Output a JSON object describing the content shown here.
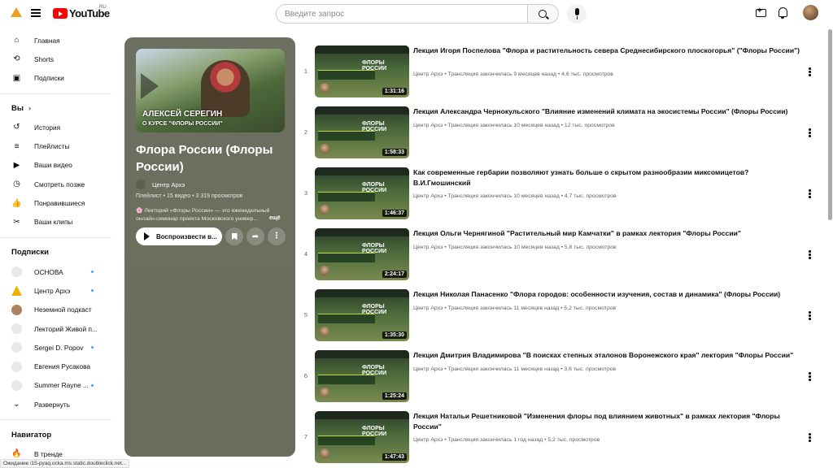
{
  "header": {
    "logo_text": "YouTube",
    "logo_region": "RU",
    "search_placeholder": "Введите запрос"
  },
  "sidebar": {
    "main": [
      {
        "label": "Главная",
        "icon": "home-icon"
      },
      {
        "label": "Shorts",
        "icon": "shorts-icon"
      },
      {
        "label": "Подписки",
        "icon": "subscriptions-icon"
      }
    ],
    "you_header": "Вы",
    "you": [
      {
        "label": "История",
        "icon": "history-icon"
      },
      {
        "label": "Плейлисты",
        "icon": "playlists-icon"
      },
      {
        "label": "Ваши видео",
        "icon": "your-videos-icon"
      },
      {
        "label": "Смотреть позже",
        "icon": "watch-later-icon"
      },
      {
        "label": "Понравившиеся",
        "icon": "like-icon"
      },
      {
        "label": "Ваши клипы",
        "icon": "clips-icon"
      }
    ],
    "subs_header": "Подписки",
    "subs": [
      {
        "label": "ОСНОВА",
        "color": "#e8e8e8",
        "dot": true
      },
      {
        "label": "Центр Архэ",
        "color": "#f0b000",
        "dot": true
      },
      {
        "label": "Неземной подкаст",
        "color": "#b08060",
        "dot": false
      },
      {
        "label": "Лекторий Живой п...",
        "color": "#e8e8e8",
        "dot": false
      },
      {
        "label": "Sergei D. Popov",
        "color": "#e8e8e8",
        "dot": true
      },
      {
        "label": "Евгения Русакова",
        "color": "#e8e8e8",
        "dot": false
      },
      {
        "label": "Summer Rayne ...",
        "color": "#e8e8e8",
        "dot": true
      }
    ],
    "expand": "Развернуть",
    "nav_header": "Навигатор",
    "nav": [
      {
        "label": "В тренде",
        "icon": "trending-icon"
      }
    ]
  },
  "playlist": {
    "thumb_line1": "АЛЕКСЕЙ СЕРЕГИН",
    "thumb_line2": "О КУРСЕ \"ФЛОРЫ РОССИИ\"",
    "title": "Флора России (Флоры России)",
    "channel": "Центр Архэ",
    "meta": "Плейлист • 15 видео • 3 319 просмотров",
    "description": "🌸 Лекторий «Флоры России» — это еженедельный онлайн-семинар проекта Московского универ...",
    "more": "ещё",
    "play_label": "Воспроизвести в...",
    "save_icon": "bookmark-icon",
    "share_icon": "share-icon",
    "more_icon": "more-vert-icon"
  },
  "videos": [
    {
      "index": "1",
      "title": "Лекция Игоря Поспелова \"Флора и растительность севера Среднесибирского плоскогорья\" (\"Флоры России\")",
      "meta": "Центр Архэ • Трансляция закончилась 9 месяцев назад • 4,6 тыс. просмотров",
      "duration": "1:31:16",
      "thumb_text": "ФЛОРЫ РОССИИ"
    },
    {
      "index": "2",
      "title": "Лекция Александра Чернокульского \"Влияние изменений климата на экосистемы России\" (Флоры России)",
      "meta": "Центр Архэ • Трансляция закончилась 10 месяцев назад • 12 тыс. просмотров",
      "duration": "1:58:33",
      "thumb_text": "ФЛОРЫ РОССИИ"
    },
    {
      "index": "3",
      "title": "Как современные гербарии позволяют узнать больше о скрытом разнообразии миксомицетов? В.И.Гмошинский",
      "meta": "Центр Архэ • Трансляция закончилась 10 месяцев назад • 4,7 тыс. просмотров",
      "duration": "1:46:37",
      "thumb_text": "ФЛОРЫ РОССИИ"
    },
    {
      "index": "4",
      "title": "Лекция Ольги Чернягиной \"Растительный мир Камчатки\" в рамках лектория \"Флоры России\"",
      "meta": "Центр Архэ • Трансляция закончилась 10 месяцев назад • 5,8 тыс. просмотров",
      "duration": "2:24:17",
      "thumb_text": "ФЛОРЫ РОССИИ"
    },
    {
      "index": "5",
      "title": "Лекция Николая Панасенко \"Флора городов: особенности изучения, состав и динамика\" (Флоры России)",
      "meta": "Центр Архэ • Трансляция закончилась 11 месяцев назад • 5,2 тыс. просмотров",
      "duration": "1:35:30",
      "thumb_text": "ФЛОРЫ РОССИИ"
    },
    {
      "index": "6",
      "title": "Лекция Дмитрия Владимирова \"В поисках степных эталонов Воронежского края\" лектория \"Флоры России\"",
      "meta": "Центр Архэ • Трансляция закончилась 11 месяцев назад • 3,6 тыс. просмотров",
      "duration": "1:25:24",
      "thumb_text": "ФЛОРЫ РОССИИ"
    },
    {
      "index": "7",
      "title": "Лекция Натальи Решетниковой \"Изменения флоры под влиянием животных\" в рамках лектория \"Флоры России\"",
      "meta": "Центр Архэ • Трансляция закончилась 1 год назад • 5,2 тыс. просмотров",
      "duration": "1:47:43",
      "thumb_text": "ФЛОРЫ РОССИИ"
    }
  ],
  "status_bar": "Ожидание i15-pyaq.ocka.ms.static.doubleclick.net...",
  "colors": {
    "accent": "#ff0000",
    "panel_bg": "#6d7060",
    "dot_new": "#3ea6ff"
  }
}
